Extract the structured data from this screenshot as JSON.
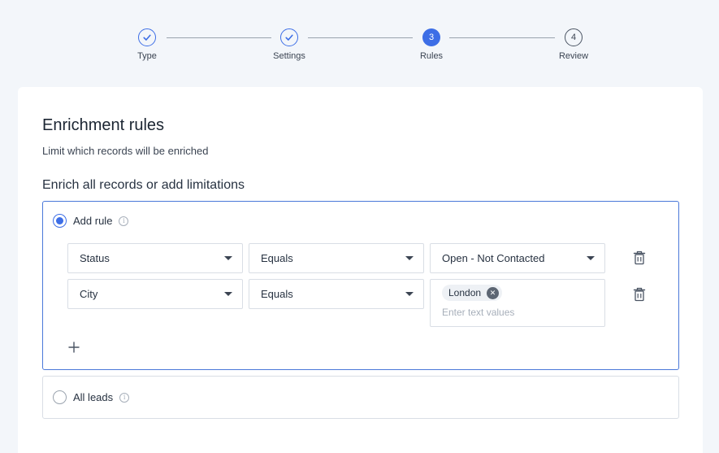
{
  "stepper": {
    "steps": [
      {
        "label": "Type",
        "number": "1",
        "state": "done"
      },
      {
        "label": "Settings",
        "number": "2",
        "state": "done"
      },
      {
        "label": "Rules",
        "number": "3",
        "state": "active"
      },
      {
        "label": "Review",
        "number": "4",
        "state": "todo"
      }
    ]
  },
  "card": {
    "title": "Enrichment rules",
    "subtitle": "Limit which records will be enriched",
    "section_title": "Enrich all records or add limitations"
  },
  "options": {
    "add_rule": {
      "label": "Add rule",
      "info_icon": "info-icon",
      "selected": true
    },
    "all_leads": {
      "label": "All leads",
      "info_icon": "info-icon",
      "selected": false
    }
  },
  "rules": [
    {
      "field": "Status",
      "operator": "Equals",
      "value": "Open - Not Contacted"
    },
    {
      "field": "City",
      "operator": "Equals",
      "chips": [
        "London"
      ],
      "placeholder": "Enter text values"
    }
  ],
  "icons": {
    "check": "check-icon",
    "caret": "caret-down-icon",
    "trash": "trash-icon",
    "add": "plus-icon",
    "chip_remove": "close-circle-icon"
  },
  "colors": {
    "accent": "#3d6ee6",
    "background": "#f3f6fa",
    "card": "#ffffff",
    "border": "#d9dee5",
    "selected_border": "#4a78d9"
  }
}
